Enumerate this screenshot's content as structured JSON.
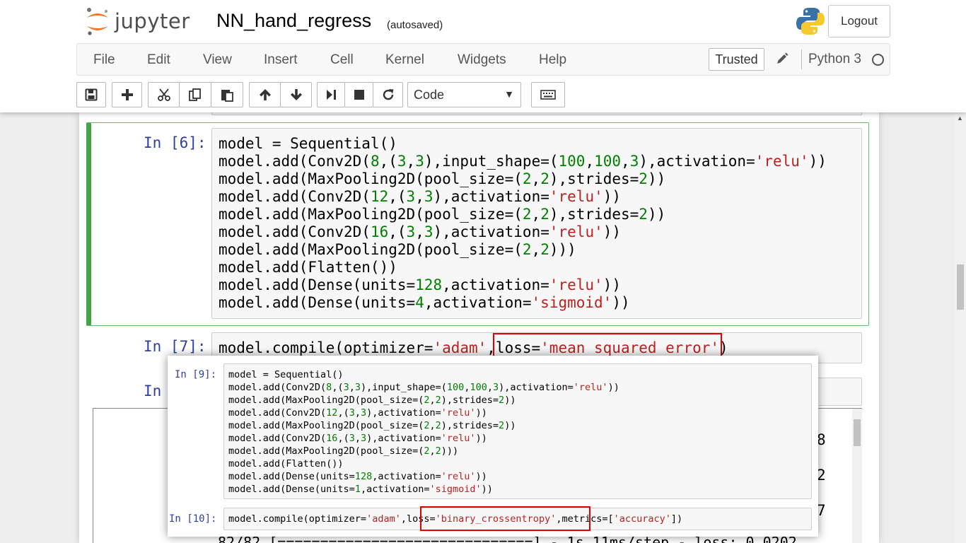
{
  "header": {
    "logo_text": "jupyter",
    "notebook_name": "NN_hand_regress",
    "autosave_status": "(autosaved)",
    "logout_label": "Logout"
  },
  "menubar": {
    "items": [
      "File",
      "Edit",
      "View",
      "Insert",
      "Cell",
      "Kernel",
      "Widgets",
      "Help"
    ],
    "trusted_label": "Trusted",
    "kernel_name": "Python 3"
  },
  "toolbar": {
    "buttons": [
      "save-icon",
      "plus-icon",
      "cut-icon",
      "copy-icon",
      "paste-icon",
      "arrow-up-icon",
      "arrow-down-icon",
      "run-icon",
      "stop-icon",
      "restart-icon",
      "keyboard-icon"
    ],
    "cell_type": "Code"
  },
  "cells": {
    "cell6": {
      "prompt": "In [6]:",
      "lines": [
        "model = Sequential()",
        "model.add(Conv2D(8,(3,3),input_shape=(100,100,3),activation='relu'))",
        "model.add(MaxPooling2D(pool_size=(2,2),strides=2))",
        "model.add(Conv2D(12,(3,3),activation='relu'))",
        "model.add(MaxPooling2D(pool_size=(2,2),strides=2))",
        "model.add(Conv2D(16,(3,3),activation='relu'))",
        "model.add(MaxPooling2D(pool_size=(2,2)))",
        "model.add(Flatten())",
        "model.add(Dense(units=128,activation='relu'))",
        "model.add(Dense(units=4,activation='sigmoid'))"
      ]
    },
    "cell7": {
      "prompt": "In [7]:",
      "code": "model.compile(optimizer='adam',loss='mean_squared_error')"
    },
    "cell8": {
      "prompt": "In"
    },
    "output": {
      "digits": [
        "8",
        "2",
        "7"
      ],
      "partial_line": "82/82 [==============================] - 1s 11ms/step - loss: 0.0202"
    }
  },
  "overlay": {
    "cell9": {
      "prompt": "In [9]:",
      "lines": [
        "model = Sequential()",
        "model.add(Conv2D(8,(3,3),input_shape=(100,100,3),activation='relu'))",
        "model.add(MaxPooling2D(pool_size=(2,2),strides=2))",
        "model.add(Conv2D(12,(3,3),activation='relu'))",
        "model.add(MaxPooling2D(pool_size=(2,2),strides=2))",
        "model.add(Conv2D(16,(3,3),activation='relu'))",
        "model.add(MaxPooling2D(pool_size=(2,2)))",
        "model.add(Flatten())",
        "model.add(Dense(units=128,activation='relu'))",
        "model.add(Dense(units=1,activation='sigmoid'))"
      ]
    },
    "cell10": {
      "prompt": "In [10]:",
      "code": "model.compile(optimizer='adam',loss='binary_crossentropy',metrics=['accuracy'])"
    }
  },
  "colors": {
    "prompt_blue": "#303f9f",
    "string_red": "#ba2121",
    "number_green": "#008000",
    "selected_cell_green": "#42a548",
    "highlight_red": "#e00000"
  }
}
